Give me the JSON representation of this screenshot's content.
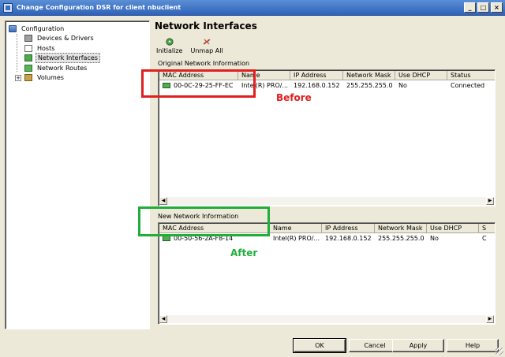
{
  "window": {
    "title": "Change Configuration DSR for client nbuclient",
    "controls": {
      "minimize": "_",
      "maximize": "□",
      "close": "×"
    }
  },
  "tree": {
    "root": {
      "label": "Configuration",
      "icon": "computer-icon",
      "expander": "−"
    },
    "items": [
      {
        "label": "Devices & Drivers",
        "icon": "devices-icon"
      },
      {
        "label": "Hosts",
        "icon": "hosts-icon"
      },
      {
        "label": "Network Interfaces",
        "icon": "network-interface-icon",
        "selected": true
      },
      {
        "label": "Network Routes",
        "icon": "network-routes-icon"
      },
      {
        "label": "Volumes",
        "icon": "volumes-icon",
        "expander": "+"
      }
    ]
  },
  "panel": {
    "title": "Network Interfaces",
    "toolbar": {
      "initialize": {
        "label": "Initialize",
        "icon": "initialize-icon"
      },
      "unmap_all": {
        "label": "Unmap All",
        "icon": "unmap-icon"
      }
    },
    "original": {
      "label": "Original Network Information",
      "columns": [
        "MAC Address",
        "Name",
        "IP Address",
        "Network Mask",
        "Use DHCP",
        "Status"
      ],
      "rows": [
        {
          "mac": "00-0C-29-25-FF-EC",
          "name": "Intel(R) PRO/...",
          "ip": "192.168.0.152",
          "mask": "255.255.255.0",
          "dhcp": "No",
          "status": "Connected"
        }
      ]
    },
    "new": {
      "label": "New Network Information",
      "columns": [
        "MAC Address",
        "Name",
        "IP Address",
        "Network Mask",
        "Use DHCP",
        "S"
      ],
      "rows": [
        {
          "mac": "00-50-56-2A-F8-14",
          "name": "Intel(R) PRO/...",
          "ip": "192.168.0.152",
          "mask": "255.255.255.0",
          "dhcp": "No",
          "status": "C"
        }
      ]
    }
  },
  "annotations": {
    "before": {
      "label": "Before",
      "color": "#e02020"
    },
    "after": {
      "label": "After",
      "color": "#1fae3a"
    }
  },
  "buttons": {
    "ok": "OK",
    "cancel": "Cancel",
    "apply": "Apply",
    "help": "Help"
  },
  "colors": {
    "titlebar": "#2f62b8",
    "face": "#ece9d8"
  }
}
